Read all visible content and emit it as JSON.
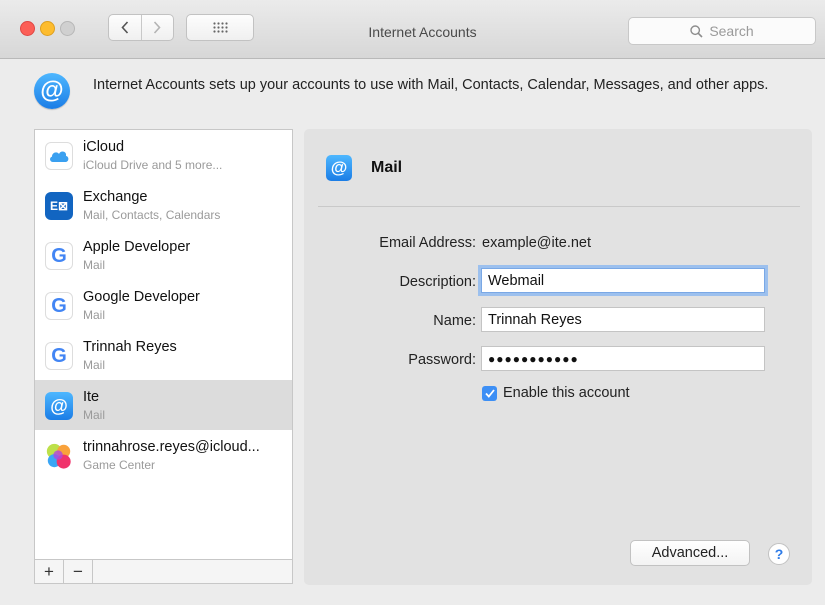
{
  "window": {
    "title": "Internet Accounts",
    "search_placeholder": "Search"
  },
  "header": {
    "description": "Internet Accounts sets up your accounts to use with Mail, Contacts, Calendar, Messages, and other apps."
  },
  "accounts": [
    {
      "name": "iCloud",
      "sub": "iCloud Drive and 5 more...",
      "icon": "icloud-icon"
    },
    {
      "name": "Exchange",
      "sub": "Mail, Contacts, Calendars",
      "icon": "exchange-icon"
    },
    {
      "name": "Apple Developer",
      "sub": "Mail",
      "icon": "google-icon"
    },
    {
      "name": "Google Developer",
      "sub": "Mail",
      "icon": "google-icon"
    },
    {
      "name": "Trinnah Reyes",
      "sub": "Mail",
      "icon": "google-icon"
    },
    {
      "name": "Ite",
      "sub": "Mail",
      "icon": "mail-at-icon",
      "selected": true
    },
    {
      "name": "trinnahrose.reyes@icloud...",
      "sub": "Game Center",
      "icon": "game-center-icon"
    }
  ],
  "list_controls": {
    "add": "+",
    "remove": "−"
  },
  "detail": {
    "title": "Mail",
    "email_label": "Email Address:",
    "email_value": "example@ite.net",
    "description_label": "Description:",
    "description_value": "Webmail",
    "name_label": "Name:",
    "name_value": "Trinnah Reyes",
    "password_label": "Password:",
    "password_value": "●●●●●●●●●●●",
    "enable_label": "Enable this account",
    "enable_checked": true,
    "advanced_label": "Advanced...",
    "help_label": "?"
  },
  "colors": {
    "accent": "#3d8ff5",
    "close": "#fc5f57",
    "minimize": "#fdbc2e",
    "selected_row": "#dcdcdc"
  }
}
